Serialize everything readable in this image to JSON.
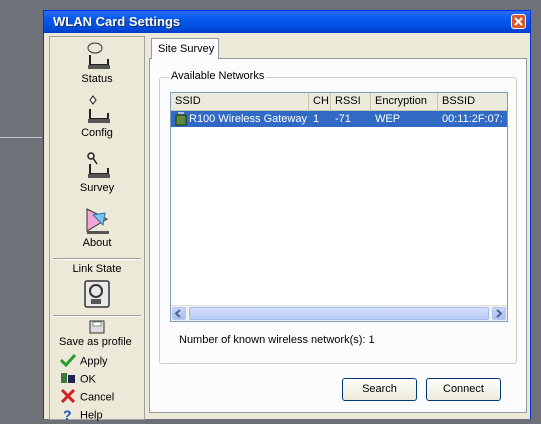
{
  "window": {
    "title": "WLAN Card Settings"
  },
  "nav": {
    "status": "Status",
    "config": "Config",
    "survey": "Survey",
    "about": "About",
    "link_state": "Link State"
  },
  "actions": {
    "save_as_profile": "Save as profile",
    "apply": "Apply",
    "ok": "OK",
    "cancel": "Cancel",
    "help": "Help"
  },
  "tab": {
    "label": "Site Survey"
  },
  "group": {
    "label": "Available Networks"
  },
  "table": {
    "columns": [
      "SSID",
      "CH",
      "RSSI",
      "Encryption",
      "BSSID"
    ],
    "rows": [
      {
        "ssid": "R100 Wireless Gateway",
        "ch": "1",
        "rssi": "-71",
        "encryption": "WEP",
        "bssid": "00:11:2F:07:"
      }
    ]
  },
  "status_text": "Number of known wireless network(s): 1",
  "buttons": {
    "search": "Search",
    "connect": "Connect"
  },
  "colors": {
    "titlebar": "#0a5cf0",
    "selection": "#316ac5",
    "window_bg": "#ece9d8"
  }
}
